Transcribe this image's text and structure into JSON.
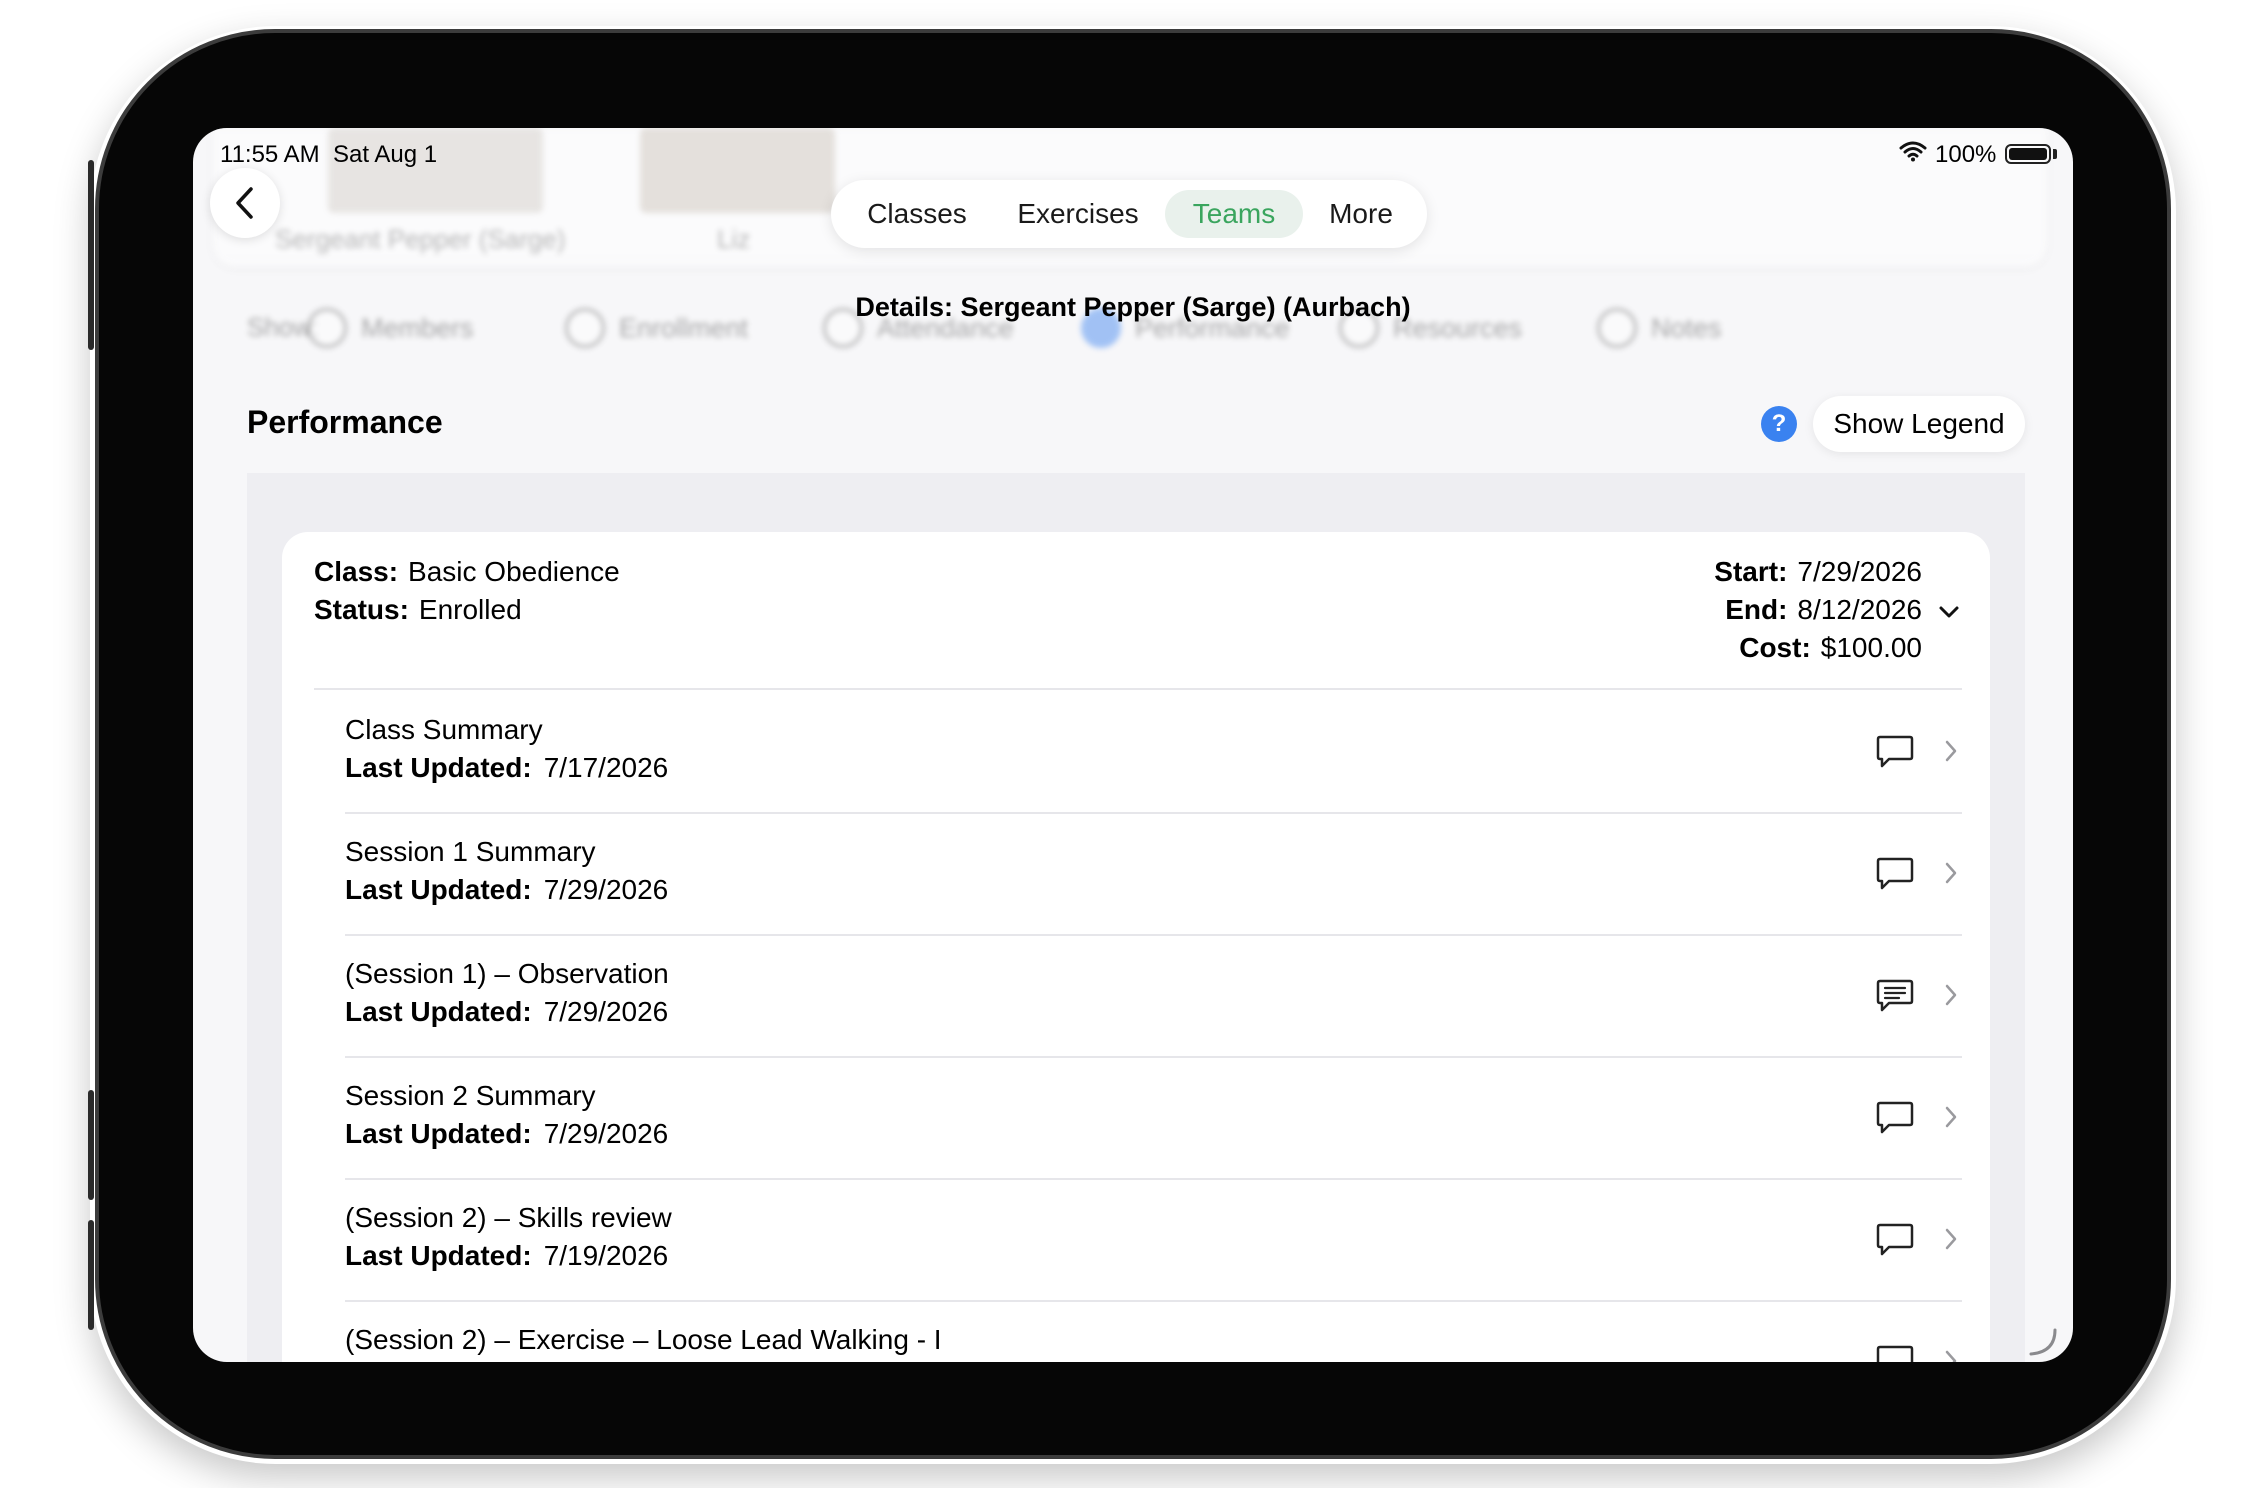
{
  "status_bar": {
    "time": "11:55 AM",
    "date": "Sat Aug 1",
    "battery": "100%"
  },
  "background": {
    "names": [
      "Sergeant Pepper (Sarge)",
      "Liz"
    ],
    "show_label": "Show:",
    "options": [
      "Members",
      "Enrollment",
      "Attendance",
      "Performance",
      "Resources",
      "Notes"
    ],
    "selected_option": "Performance"
  },
  "tabs": [
    {
      "label": "Classes"
    },
    {
      "label": "Exercises"
    },
    {
      "label": "Teams",
      "selected": true
    },
    {
      "label": "More"
    }
  ],
  "details_title": "Details: Sergeant Pepper (Sarge) (Aurbach)",
  "section": {
    "title": "Performance",
    "help": "?",
    "legend_button": "Show Legend"
  },
  "enrollment": {
    "class_label": "Class:",
    "class_value": "Basic Obedience",
    "status_label": "Status:",
    "status_value": "Enrolled",
    "start_label": "Start:",
    "start_value": "7/29/2026",
    "end_label": "End:",
    "end_value": "8/12/2026",
    "cost_label": "Cost:",
    "cost_value": "$100.00"
  },
  "rows": [
    {
      "title": "Class Summary",
      "updated_label": "Last Updated:",
      "updated": "7/17/2026",
      "icon": "comment-icon"
    },
    {
      "title": "Session 1 Summary",
      "updated_label": "Last Updated:",
      "updated": "7/29/2026",
      "icon": "comment-icon"
    },
    {
      "title": " (Session 1) – Observation",
      "updated_label": "Last Updated:",
      "updated": "7/29/2026",
      "icon": "comment-text-icon"
    },
    {
      "title": "Session 2 Summary",
      "updated_label": "Last Updated:",
      "updated": "7/29/2026",
      "icon": "comment-icon"
    },
    {
      "title": " (Session 2) – Skills review",
      "updated_label": "Last Updated:",
      "updated": "7/19/2026",
      "icon": "comment-icon"
    },
    {
      "title": " (Session 2) – Exercise – Loose Lead Walking - I",
      "icon": "comment-icon"
    }
  ],
  "colors": {
    "accent_green": "#3aa55e",
    "help_blue": "#3a82f0",
    "panel_bg": "#eeeef2"
  }
}
